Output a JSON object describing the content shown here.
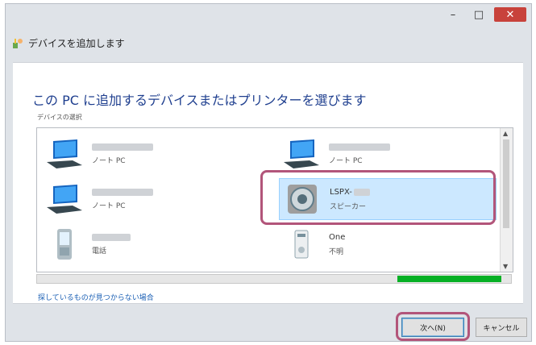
{
  "window": {
    "controls": {
      "minimize": "–",
      "maximize": "□",
      "close": "✕"
    },
    "title": "デバイスを追加します"
  },
  "main": {
    "heading": "この PC に追加するデバイスまたはプリンターを選びます",
    "subheading": "デバイスの選択",
    "devices": [
      {
        "name": "",
        "type": "ノート PC",
        "icon": "laptop-icon",
        "selected": false
      },
      {
        "name": "",
        "type": "ノート PC",
        "icon": "laptop-icon",
        "selected": false
      },
      {
        "name": "",
        "type": "ノート PC",
        "icon": "laptop-icon",
        "selected": false
      },
      {
        "name": "LSPX-",
        "type": "スピーカー",
        "icon": "speaker-icon",
        "selected": true
      },
      {
        "name": "",
        "type": "電話",
        "icon": "phone-icon",
        "selected": false
      },
      {
        "name": "One",
        "type": "不明",
        "icon": "device-icon",
        "selected": false
      }
    ],
    "progress": 0.22,
    "help_link": "探しているものが見つからない場合"
  },
  "footer": {
    "next_label": "次へ(N)",
    "cancel_label": "キャンセル"
  },
  "colors": {
    "heading": "#1f3f8f",
    "progress_fill": "#06b025",
    "highlight": "#b2557a",
    "selection": "#cce8ff",
    "link": "#1a5fb4"
  }
}
